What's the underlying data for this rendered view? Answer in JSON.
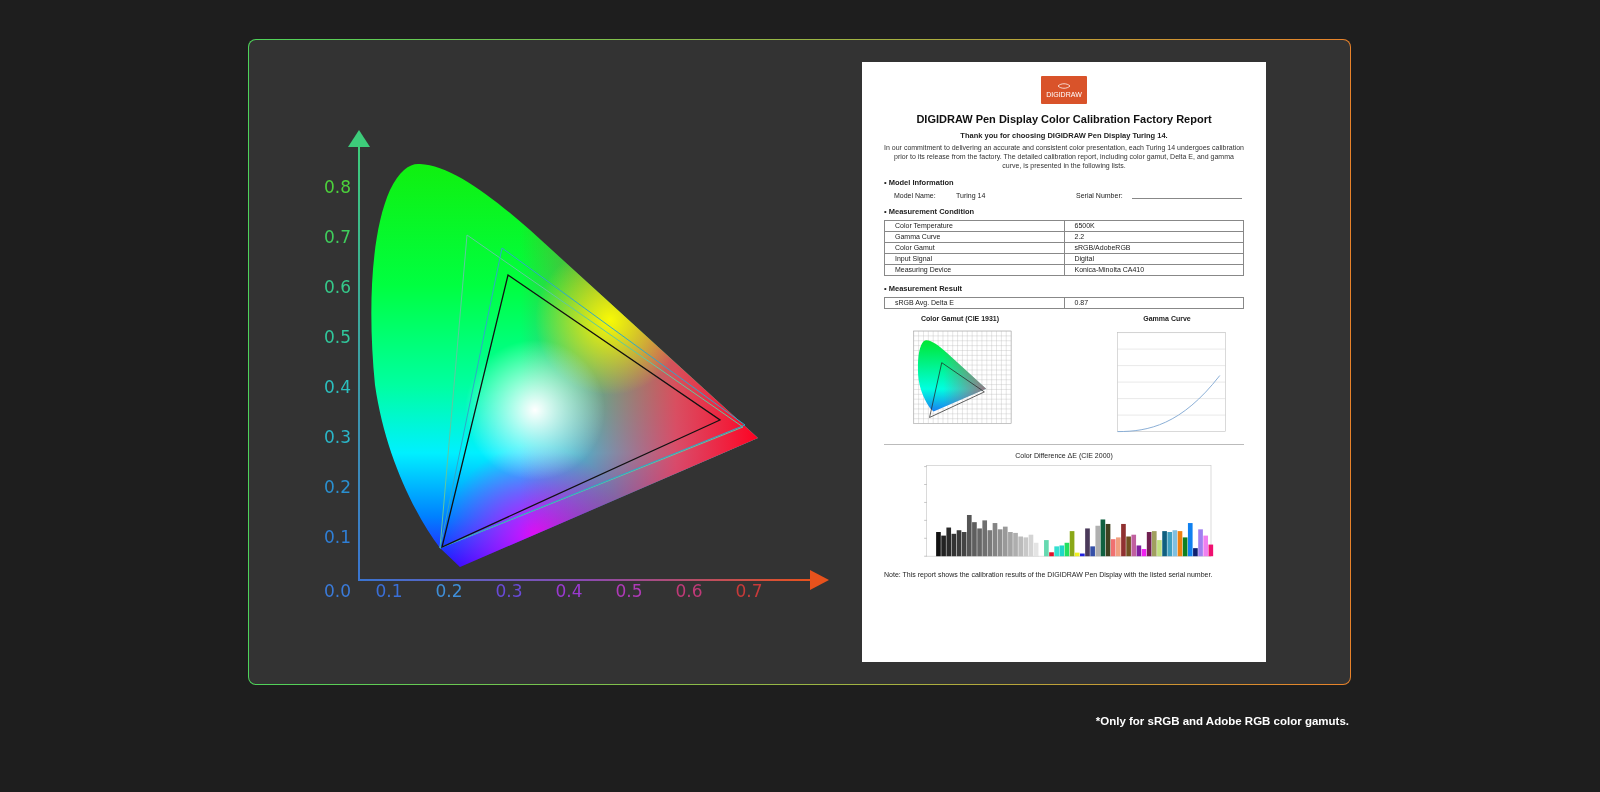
{
  "gamut_diagram": {
    "y_ticks": [
      "0.8",
      "0.7",
      "0.6",
      "0.5",
      "0.4",
      "0.3",
      "0.2",
      "0.1"
    ],
    "origin_label": "0.0",
    "x_ticks": [
      "0.1",
      "0.2",
      "0.3",
      "0.4",
      "0.5",
      "0.6",
      "0.7"
    ]
  },
  "report": {
    "logo_text": "DIGIDRAW",
    "title": "DIGIDRAW Pen Display Color Calibration Factory Report",
    "subtitle": "Thank you for choosing DIGIDRAW Pen Display Turing 14.",
    "intro": "In our commitment to delivering an accurate and consistent color presentation, each Turing 14 undergoes calibration prior to its release from the factory. The detailed calibration report, including color gamut, Delta E, and gamma curve, is presented in the following lists.",
    "model_section": "• Model Information",
    "model_name_label": "Model Name:",
    "model_name_value": "Turing 14",
    "serial_label": "Serial Number:",
    "condition_section": "• Measurement Condition",
    "condition_rows": [
      {
        "label": "Color Temperature",
        "value": "6500K"
      },
      {
        "label": "Gamma Curve",
        "value": "2.2"
      },
      {
        "label": "Color Gamut",
        "value": "sRGB/AdobeRGB"
      },
      {
        "label": "Input Signal",
        "value": "Digital"
      },
      {
        "label": "Measuring Device",
        "value": "Konica-Minolta CA410"
      }
    ],
    "result_section": "• Measurement Result",
    "result_rows": [
      {
        "label": "sRGB Avg. Delta E",
        "value": "0.87"
      }
    ],
    "gamut_heading": "Color Gamut (CIE 1931)",
    "gamma_heading": "Gamma Curve",
    "delta_heading": "Color Difference ΔE (CIE 2000)",
    "note": "Note: This report shows the calibration results of the DIGIDRAW Pen Display with the listed serial number."
  },
  "footnote": "*Only for sRGB and Adobe RGB color gamuts."
}
